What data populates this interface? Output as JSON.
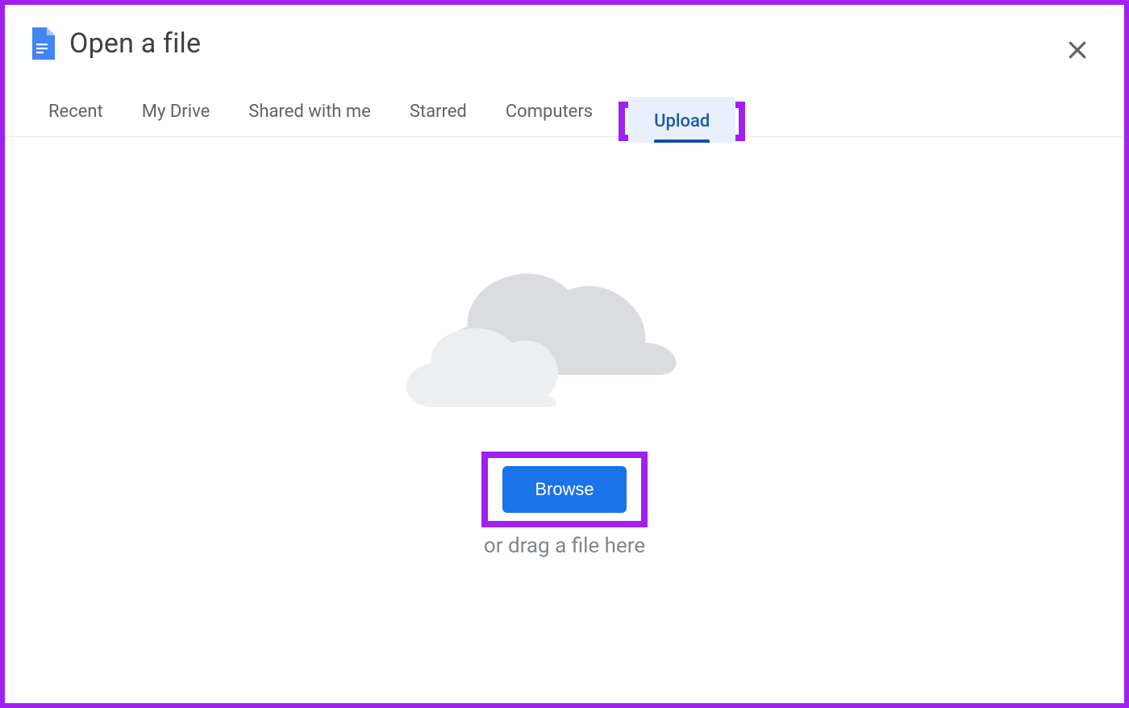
{
  "dialog": {
    "title": "Open a file"
  },
  "tabs": {
    "recent": "Recent",
    "my_drive": "My Drive",
    "shared": "Shared with me",
    "starred": "Starred",
    "computers": "Computers",
    "upload": "Upload"
  },
  "upload": {
    "browse_label": "Browse",
    "drag_hint": "or drag a file here"
  }
}
